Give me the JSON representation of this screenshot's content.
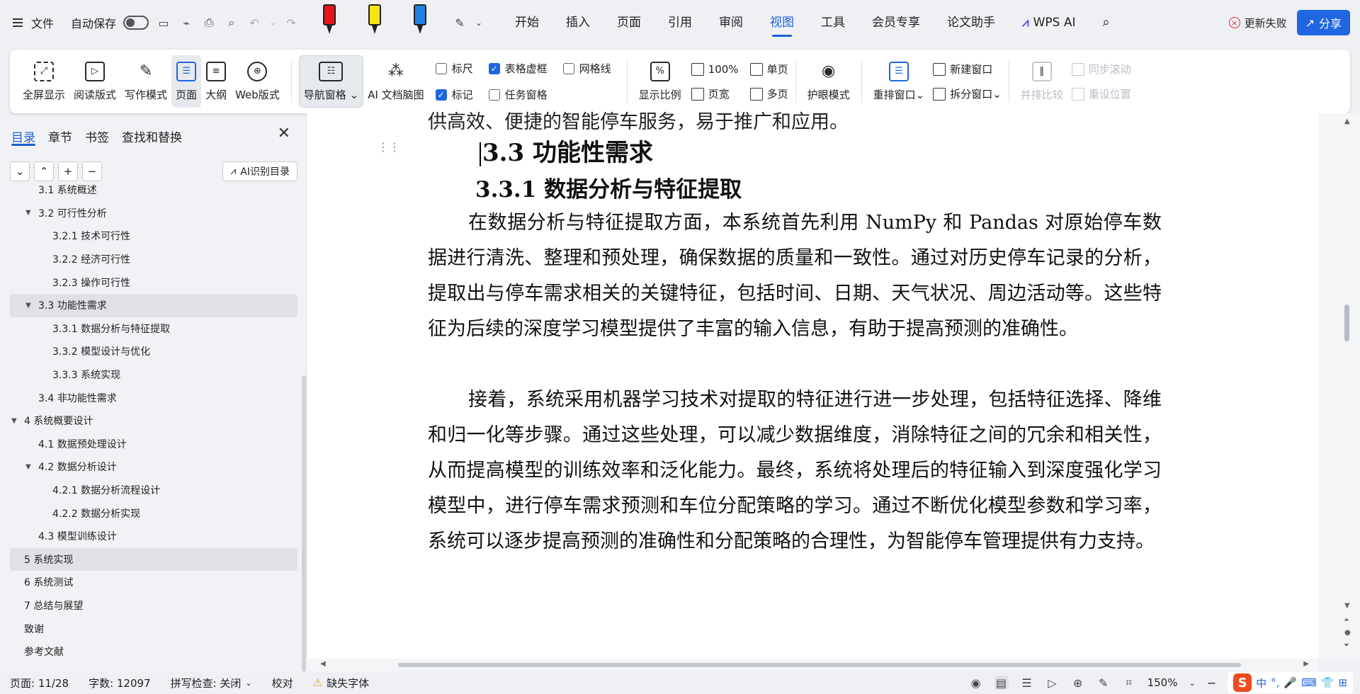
{
  "menubar": {
    "file_label": "文件",
    "autosave_label": "自动保存",
    "tabs": [
      "开始",
      "插入",
      "页面",
      "引用",
      "审阅",
      "视图",
      "工具",
      "会员专享",
      "论文助手"
    ],
    "wps_ai_label": "WPS AI",
    "update_failed_label": "更新失败",
    "share_label": "分享",
    "accent": "#1f66e0"
  },
  "toolbar": {
    "fullscreen": "全屏显示",
    "read_mode": "阅读版式",
    "write_mode": "写作模式",
    "page": "页面",
    "outline": "大纲",
    "web": "Web版式",
    "nav_pane": "导航窗格",
    "ai_mindmap": "AI 文档脑图",
    "ruler": "标尺",
    "table_gridlines": "表格虚框",
    "gridlines": "网格线",
    "marks": "标记",
    "task_pane": "任务窗格",
    "zoom_ratio": "显示比例",
    "zoom_100": "100%",
    "page_width": "页宽",
    "single_page": "单页",
    "multi_page": "多页",
    "eye_care": "护眼模式",
    "rearrange_window": "重排窗口",
    "new_window": "新建窗口",
    "split_window": "拆分窗口",
    "side_by_side": "并排比较",
    "sync_scroll": "同步滚动",
    "reset_position": "重设位置"
  },
  "sidebar": {
    "tabs": [
      "目录",
      "章节",
      "书签",
      "查找和替换"
    ],
    "ai_toc_label": "AI识别目录",
    "items": [
      {
        "label": "3.1  系统概述",
        "level": 2,
        "arrow": ""
      },
      {
        "label": "3.2  可行性分析",
        "level": 2,
        "arrow": "▼"
      },
      {
        "label": "3.2.1  技术可行性",
        "level": 3,
        "arrow": ""
      },
      {
        "label": "3.2.2  经济可行性",
        "level": 3,
        "arrow": ""
      },
      {
        "label": "3.2.3  操作可行性",
        "level": 3,
        "arrow": ""
      },
      {
        "label": "3.3  功能性需求",
        "level": 2,
        "arrow": "▼"
      },
      {
        "label": "3.3.1  数据分析与特征提取",
        "level": 3,
        "arrow": ""
      },
      {
        "label": "3.3.2  模型设计与优化",
        "level": 3,
        "arrow": ""
      },
      {
        "label": "3.3.3  系统实现",
        "level": 3,
        "arrow": ""
      },
      {
        "label": "3.4  非功能性需求",
        "level": 2,
        "arrow": ""
      },
      {
        "label": "4  系统概要设计",
        "level": 1,
        "arrow": "▼"
      },
      {
        "label": "4.1  数据预处理设计",
        "level": 2,
        "arrow": ""
      },
      {
        "label": "4.2  数据分析设计",
        "level": 2,
        "arrow": "▼"
      },
      {
        "label": "4.2.1  数据分析流程设计",
        "level": 3,
        "arrow": ""
      },
      {
        "label": "4.2.2  数据分析实现",
        "level": 3,
        "arrow": ""
      },
      {
        "label": "4.3  模型训练设计",
        "level": 2,
        "arrow": ""
      },
      {
        "label": "5  系统实现",
        "level": 1,
        "arrow": ""
      },
      {
        "label": "6  系统测试",
        "level": 1,
        "arrow": ""
      },
      {
        "label": "7  总结与展望",
        "level": 1,
        "arrow": ""
      },
      {
        "label": "致谢",
        "level": 1,
        "arrow": ""
      },
      {
        "label": "参考文献",
        "level": 1,
        "arrow": ""
      }
    ]
  },
  "document": {
    "top_clipped": "供高效、便捷的智能停车服务，易于推广和应用。",
    "heading2": "3.3  功能性需求",
    "heading3": "3.3.1  数据分析与特征提取",
    "para1": "在数据分析与特征提取方面，本系统首先利用 NumPy 和 Pandas 对原始停车数据进行清洗、整理和预处理，确保数据的质量和一致性。通过对历史停车记录的分析，提取出与停车需求相关的关键特征，包括时间、日期、天气状况、周边活动等。这些特征为后续的深度学习模型提供了丰富的输入信息，有助于提高预测的准确性。",
    "para2": "接着，系统采用机器学习技术对提取的特征进行进一步处理，包括特征选择、降维和归一化等步骤。通过这些处理，可以减少数据维度，消除特征之间的冗余和相关性，从而提高模型的训练效率和泛化能力。最终，系统将处理后的特征输入到深度强化学习模型中，进行停车需求预测和车位分配策略的学习。通过不断优化模型参数和学习率，系统可以逐步提高预测的准确性和分配策略的合理性，为智能停车管理提供有力支持。"
  },
  "statusbar": {
    "page": "页面: 11/28",
    "words": "字数: 12097",
    "spellcheck": "拼写检查: 关闭",
    "proofread": "校对",
    "missing_font": "缺失字体",
    "zoom": "150%",
    "ime_lang": "中"
  }
}
